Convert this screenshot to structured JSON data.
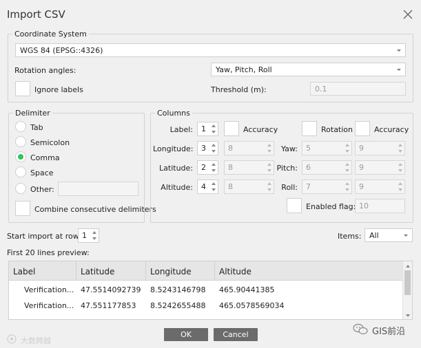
{
  "dialog": {
    "title": "Import CSV"
  },
  "coord": {
    "legend": "Coordinate System",
    "crs_value": "WGS 84 (EPSG::4326)",
    "rotation_label": "Rotation angles:",
    "rotation_value": "Yaw, Pitch, Roll",
    "ignore_labels": "Ignore labels",
    "threshold_label": "Threshold (m):",
    "threshold_value": "0.1"
  },
  "delimiter": {
    "legend": "Delimiter",
    "options": [
      "Tab",
      "Semicolon",
      "Comma",
      "Space",
      "Other:"
    ],
    "selected": "Comma",
    "combine_label": "Combine consecutive delimiters"
  },
  "columns": {
    "legend": "Columns",
    "label_label": "Label:",
    "label_value": "1",
    "accuracy_label": "Accuracy",
    "rotation_label": "Rotation",
    "accuracy2_label": "Accuracy",
    "longitude_label": "Longitude:",
    "longitude_value": "3",
    "longitude_acc": "8",
    "latitude_label": "Latitude:",
    "latitude_value": "2",
    "latitude_acc": "8",
    "altitude_label": "Altitude:",
    "altitude_value": "4",
    "altitude_acc": "8",
    "yaw_label": "Yaw:",
    "yaw_value": "5",
    "yaw_acc": "9",
    "pitch_label": "Pitch:",
    "pitch_value": "6",
    "pitch_acc": "9",
    "roll_label": "Roll:",
    "roll_value": "7",
    "roll_acc": "9",
    "enabled_label": "Enabled flag:",
    "enabled_value": "10"
  },
  "import": {
    "start_label": "Start import at row:",
    "start_value": "1",
    "items_label": "Items:",
    "items_value": "All",
    "preview_label": "First 20 lines preview:"
  },
  "preview": {
    "headers": [
      "Label",
      "Latitude",
      "Longitude",
      "Altitude"
    ],
    "rows": [
      [
        "Verification...",
        "47.5514092739",
        "8.5243146798",
        "465.90441385"
      ],
      [
        "Verification...",
        "47.551177853",
        "8.5242655488",
        "465.0578569034"
      ]
    ]
  },
  "buttons": {
    "ok": "OK",
    "cancel": "Cancel"
  },
  "watermark": {
    "left": "大数跨越",
    "right": "GIS前沿"
  }
}
